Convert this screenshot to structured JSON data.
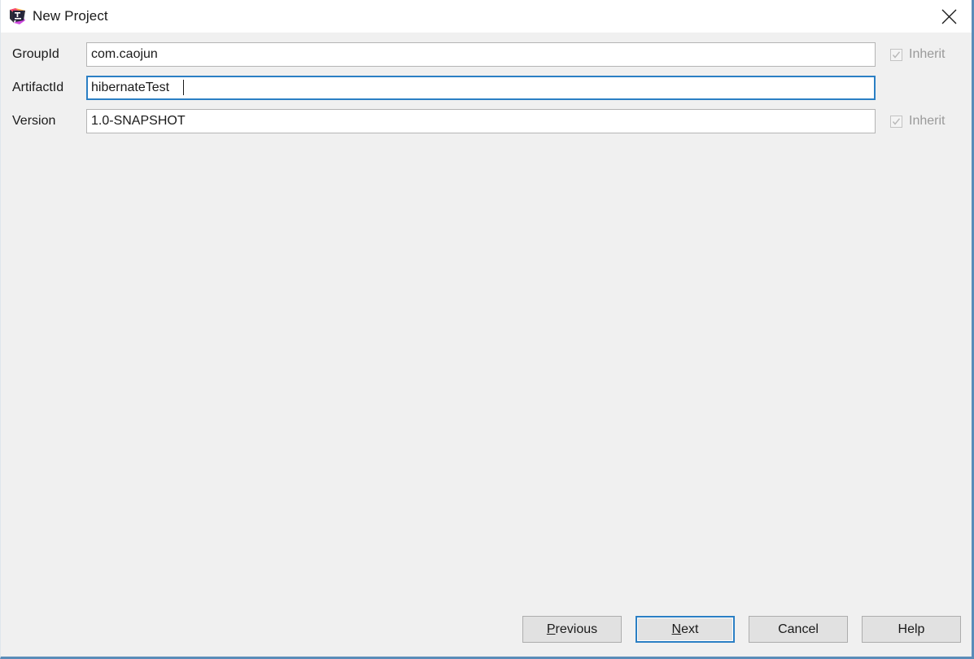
{
  "window": {
    "title": "New Project",
    "app_icon": "intellij-idea-icon",
    "close_icon": "close-icon",
    "accent_color": "#2b7fc4",
    "background_color": "#f0f0f0",
    "titlebar_color": "#ffffff"
  },
  "form": {
    "rows": [
      {
        "label": "GroupId",
        "value": "com.caojun",
        "placeholder": "",
        "focused": false,
        "has_inherit": true,
        "inherit_label": "Inherit",
        "inherit_checked": true,
        "inherit_enabled": false
      },
      {
        "label": "ArtifactId",
        "value": "hibernateTest",
        "placeholder": "",
        "focused": true,
        "has_inherit": false,
        "inherit_label": "",
        "inherit_checked": false,
        "inherit_enabled": false
      },
      {
        "label": "Version",
        "value": "1.0-SNAPSHOT",
        "placeholder": "",
        "focused": false,
        "has_inherit": true,
        "inherit_label": "Inherit",
        "inherit_checked": true,
        "inherit_enabled": false
      }
    ]
  },
  "buttons": [
    {
      "name": "previous",
      "label": "Previous",
      "mnemonic": "P",
      "focused": false
    },
    {
      "name": "next",
      "label": "Next",
      "mnemonic": "N",
      "focused": true
    },
    {
      "name": "cancel",
      "label": "Cancel",
      "mnemonic": "",
      "focused": false
    },
    {
      "name": "help",
      "label": "Help",
      "mnemonic": "",
      "focused": false
    }
  ]
}
